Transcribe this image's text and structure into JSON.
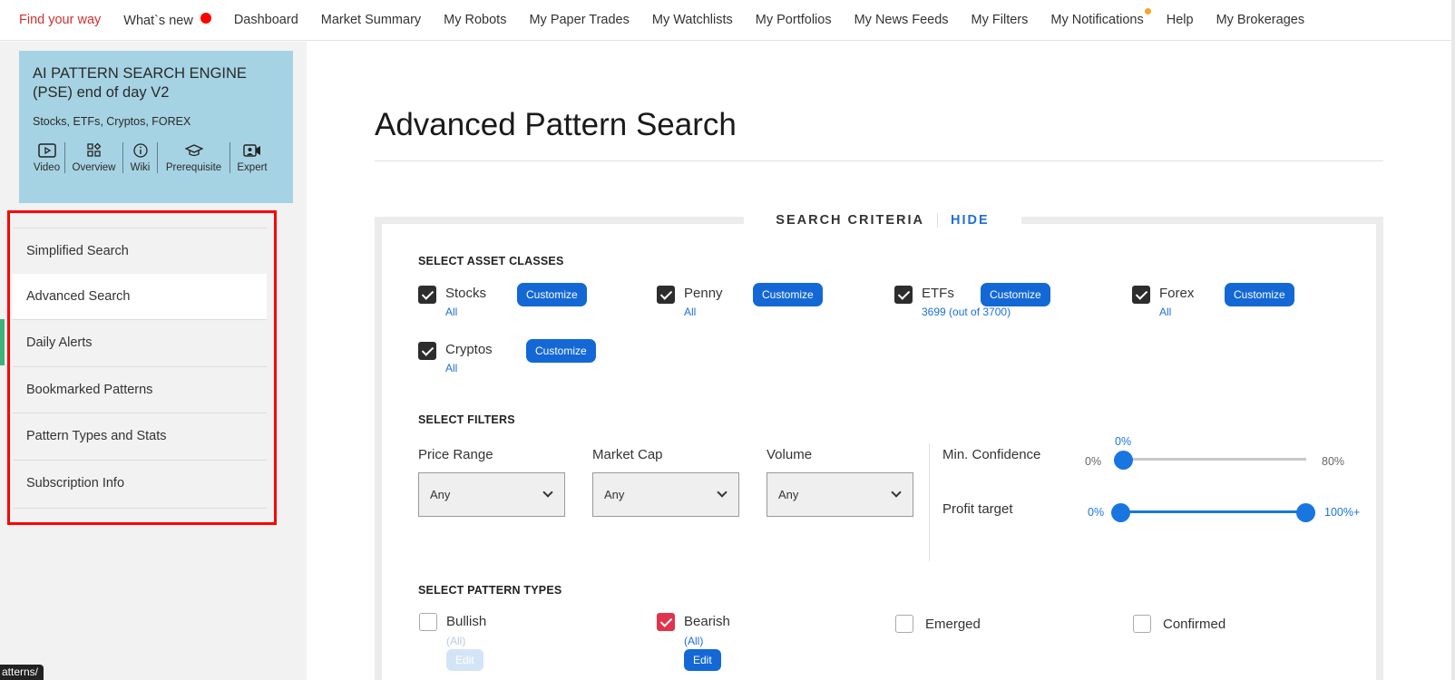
{
  "nav": {
    "items": [
      {
        "label": "Find your way"
      },
      {
        "label": "What`s new"
      },
      {
        "label": "Dashboard"
      },
      {
        "label": "Market Summary"
      },
      {
        "label": "My Robots"
      },
      {
        "label": "My Paper Trades"
      },
      {
        "label": "My Watchlists"
      },
      {
        "label": "My Portfolios"
      },
      {
        "label": "My News Feeds"
      },
      {
        "label": "My Filters"
      },
      {
        "label": "My Notifications"
      },
      {
        "label": "Help"
      },
      {
        "label": "My Brokerages"
      }
    ],
    "colors": {
      "active": "#d32f2f",
      "new_dot": "#ff0000",
      "notification_dot": "#f5a623"
    }
  },
  "promo": {
    "title": "AI PATTERN SEARCH ENGINE (PSE) end of day V2",
    "subtitle": "Stocks, ETFs, Cryptos, FOREX",
    "icons": [
      {
        "label": "Video",
        "icon": "play-icon"
      },
      {
        "label": "Overview",
        "icon": "grid-icon"
      },
      {
        "label": "Wiki",
        "icon": "info-icon"
      },
      {
        "label": "Prerequisite",
        "icon": "graduation-cap-icon"
      },
      {
        "label": "Expert",
        "icon": "video-user-icon"
      }
    ],
    "background": "#a6d3e3"
  },
  "sidebar": {
    "items": [
      {
        "label": "Simplified Search"
      },
      {
        "label": "Advanced Search"
      },
      {
        "label": "Daily Alerts"
      },
      {
        "label": "Bookmarked Patterns"
      },
      {
        "label": "Pattern Types and Stats"
      },
      {
        "label": "Subscription Info"
      }
    ],
    "active": "Advanced Search",
    "highlight_color": "#ff0000",
    "active_bar_color": "#3bb37a"
  },
  "status_url": "atterns/",
  "main": {
    "title": "Advanced Pattern Search",
    "criteria_label": "SEARCH CRITERIA",
    "hide_label": "HIDE",
    "asset_section": "SELECT ASSET CLASSES",
    "assets": [
      {
        "name": "Stocks",
        "sub": "All",
        "checked": true,
        "button": "Customize"
      },
      {
        "name": "Penny",
        "sub": "All",
        "checked": true,
        "button": "Customize"
      },
      {
        "name": "ETFs",
        "sub": "3699 (out of 3700)",
        "checked": true,
        "button": "Customize"
      },
      {
        "name": "Forex",
        "sub": "All",
        "checked": true,
        "button": "Customize"
      },
      {
        "name": "Cryptos",
        "sub": "All",
        "checked": true,
        "button": "Customize"
      }
    ],
    "filter_section": "SELECT FILTERS",
    "filters": [
      {
        "label": "Price Range",
        "value": "Any"
      },
      {
        "label": "Market Cap",
        "value": "Any"
      },
      {
        "label": "Volume",
        "value": "Any"
      }
    ],
    "sliders": {
      "confidence": {
        "label": "Min. Confidence",
        "current": "0%",
        "min": "0%",
        "max": "80%",
        "value": 0
      },
      "profit": {
        "label": "Profit target",
        "min": "0%",
        "max": "100%+",
        "low": 0,
        "high": 100
      }
    },
    "pattern_section": "SELECT PATTERN TYPES",
    "patterns": [
      {
        "name": "Bullish",
        "sub": "(All)",
        "button": "Edit",
        "checked": false
      },
      {
        "name": "Bearish",
        "sub": "(All)",
        "button": "Edit",
        "checked": true
      },
      {
        "name": "Emerged",
        "checked": false
      },
      {
        "name": "Confirmed",
        "checked": false
      }
    ],
    "accent": "#1368d6"
  }
}
